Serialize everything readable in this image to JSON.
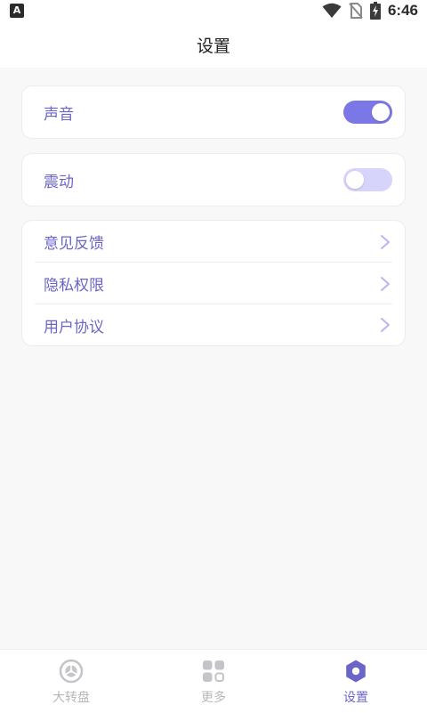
{
  "status_bar": {
    "time": "6:46",
    "left_icon": "A",
    "icons": [
      "wifi-icon",
      "no-sim-icon",
      "battery-charging-icon"
    ]
  },
  "header": {
    "title": "设置"
  },
  "settings": {
    "sound": {
      "label": "声音",
      "enabled": true
    },
    "vibration": {
      "label": "震动",
      "enabled": false
    },
    "links": [
      {
        "label": "意见反馈",
        "icon": "chevron-right-icon"
      },
      {
        "label": "隐私权限",
        "icon": "chevron-right-icon"
      },
      {
        "label": "用户协议",
        "icon": "chevron-right-icon"
      }
    ]
  },
  "tabbar": {
    "tabs": [
      {
        "label": "大转盘",
        "icon": "wheel-icon",
        "active": false
      },
      {
        "label": "更多",
        "icon": "grid-icon",
        "active": false
      },
      {
        "label": "设置",
        "icon": "gear-icon",
        "active": true
      }
    ]
  },
  "colors": {
    "accent": "#6b65c9",
    "toggle_on": "#7c77e6",
    "toggle_off": "#d6d4fb",
    "inactive": "#b7b7bd"
  }
}
